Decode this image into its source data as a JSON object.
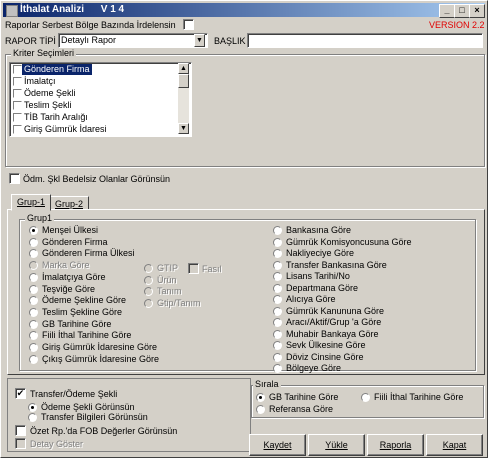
{
  "window": {
    "title": "İthalat Analizi      V 1 4",
    "min_glyph": "_",
    "max_glyph": "□",
    "close_glyph": "×"
  },
  "top": {
    "serbest_bolge_label": "Raporlar Serbest Bölge Bazında İrdelensin",
    "version": "VERSION 2.2",
    "rapor_tipi_label": "RAPOR TİPİ",
    "rapor_tipi_value": "Detaylı Rapor",
    "baslik_label": "BAŞLIK",
    "baslik_value": ""
  },
  "kriter": {
    "title": "Kriter Seçimleri",
    "items": [
      "Gönderen Firma",
      "İmalatçı",
      "Ödeme Şekli",
      "Teslim Şekli",
      "TİB Tarih Aralığı",
      "Giriş Gümrük İdaresi"
    ],
    "selected_index": 0
  },
  "odm_label": "Ödm. Şkl Bedelsiz Olanlar Görünsün",
  "tabs": [
    "Grup-1",
    "Grup-2"
  ],
  "active_tab": 0,
  "grup1": {
    "title": "Grup1",
    "left_options": [
      {
        "label": "Menşei Ülkesi",
        "on": true,
        "disabled": false
      },
      {
        "label": "Gönderen Firma",
        "on": false,
        "disabled": false
      },
      {
        "label": "Gönderen Firma Ülkesi",
        "on": false,
        "disabled": false
      },
      {
        "label": "Marka Göre",
        "on": false,
        "disabled": true
      },
      {
        "label": "İmalatçıya Göre",
        "on": false,
        "disabled": false
      },
      {
        "label": "Teşviğe Göre",
        "on": false,
        "disabled": false
      },
      {
        "label": "Ödeme Şekline Göre",
        "on": false,
        "disabled": false
      },
      {
        "label": "Teslim Şekline Göre",
        "on": false,
        "disabled": false
      },
      {
        "label": "GB Tarihine Göre",
        "on": false,
        "disabled": false
      },
      {
        "label": "Fiili İthal Tarihine Göre",
        "on": false,
        "disabled": false
      },
      {
        "label": "Giriş Gümrük İdaresine Göre",
        "on": false,
        "disabled": false
      },
      {
        "label": "Çıkış Gümrük İdaresine Göre",
        "on": false,
        "disabled": false
      }
    ],
    "middle_options": [
      "GTIP",
      "Ürün",
      "Tanım",
      "Gtip/Tanım"
    ],
    "fasil_label": "Fasıl",
    "right_options": [
      "Bankasına Göre",
      "Gümrük Komisyoncusuna Göre",
      "Nakliyeciye Göre",
      "Transfer Bankasına Göre",
      "Lisans Tarihi/No",
      "Departmana Göre",
      "Alıcıya Göre",
      "Gümrük Kanununa Göre",
      "Aracı/Aktif/Grup 'a Göre",
      "Muhabir Bankaya Göre",
      "Sevk Ülkesine Göre",
      "Döviz Cinsine Göre",
      "Bölgeye Göre"
    ]
  },
  "bottom": {
    "transfer_label": "Transfer/Ödeme Şekli",
    "odeme_gorunsun": "Ödeme Şekli Görünsün",
    "transfer_gorunsun": "Transfer Bilgileri Görünsün",
    "ozet_label": "Özet Rp.'da FOB Değerler Görünsün",
    "detay_label": "Detay Göster",
    "sirala_title": "Sırala",
    "sirala_gb": "GB Tarihine Göre",
    "sirala_fiili": "Fiili İthal Tarihine Göre",
    "sirala_referans": "Referansa Göre"
  },
  "buttons": {
    "kaydet": "Kaydet",
    "yukle": "Yükle",
    "raporla": "Raporla",
    "kapat": "Kapat"
  }
}
